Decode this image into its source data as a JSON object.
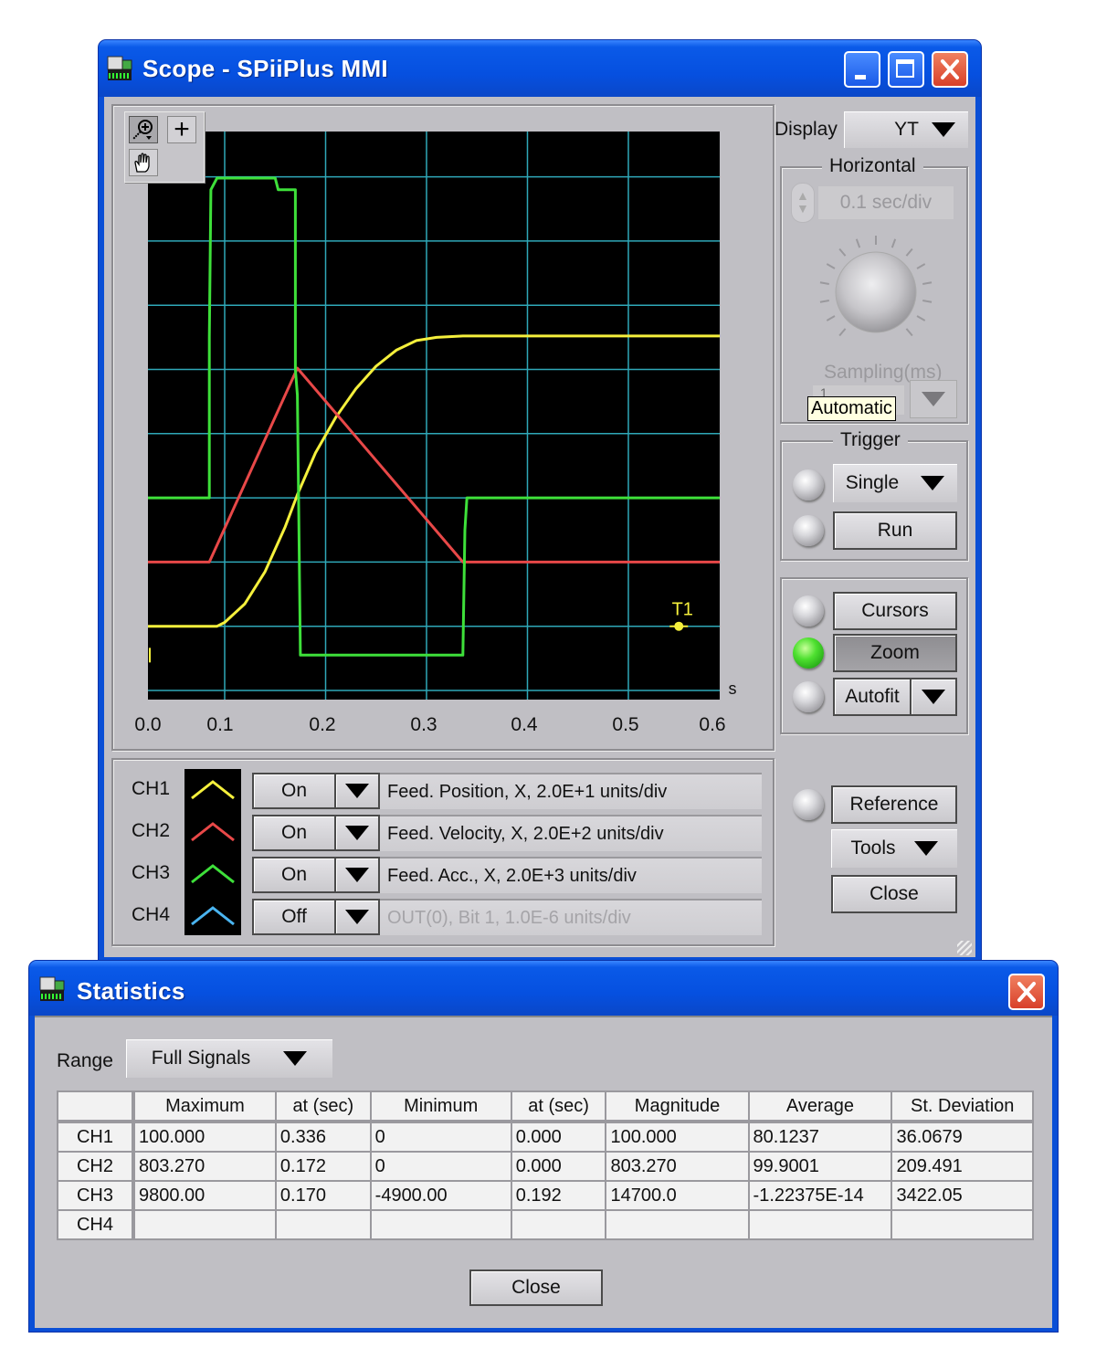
{
  "scope_window": {
    "title": "Scope - SPiiPlus MMI",
    "controls": {
      "minimize": "minimize",
      "maximize": "maximize",
      "close": "close"
    },
    "toolbar": {
      "zoom_tool": "zoom-in-tool",
      "crosshair_tool": "crosshair-tool",
      "pan_tool": "pan-hand-tool"
    },
    "display": {
      "label": "Display",
      "value": "YT"
    },
    "horizontal": {
      "group_label": "Horizontal",
      "value": "0.1 sec/div",
      "sampling_label": "Sampling(ms)",
      "sampling_value": "1",
      "tooltip": "Automatic"
    },
    "trigger": {
      "group_label": "Trigger",
      "mode": "Single",
      "run_label": "Run",
      "mode_led_on": false,
      "run_led_on": false
    },
    "view": {
      "cursors_label": "Cursors",
      "zoom_label": "Zoom",
      "autofit_label": "Autofit",
      "cursors_led_on": false,
      "zoom_led_on": true,
      "autofit_led_on": false
    },
    "misc": {
      "reference_label": "Reference",
      "tools_label": "Tools",
      "close_label": "Close",
      "reference_led_on": false
    },
    "channels": [
      {
        "name": "CH1",
        "state": "On",
        "description": "Feed. Position, X, 2.0E+1 units/div",
        "color": "#f5f03c",
        "enabled": true
      },
      {
        "name": "CH2",
        "state": "On",
        "description": "Feed. Velocity, X, 2.0E+2 units/div",
        "color": "#e84848",
        "enabled": true
      },
      {
        "name": "CH3",
        "state": "On",
        "description": "Feed. Acc., X, 2.0E+3 units/div",
        "color": "#3ee03a",
        "enabled": true
      },
      {
        "name": "CH4",
        "state": "Off",
        "description": "OUT(0), Bit 1, 1.0E-6 units/div",
        "color": "#4ab4f0",
        "enabled": false
      }
    ]
  },
  "chart_data": {
    "type": "line",
    "title": "",
    "xlabel": "s",
    "ylabel": "",
    "xlim": [
      0.0,
      0.6
    ],
    "x_ticks": [
      "0.0",
      "0.1",
      "0.2",
      "0.3",
      "0.4",
      "0.5",
      "0.6"
    ],
    "grid": true,
    "y_divisions_units": "div",
    "ylim_div": [
      -0.3,
      8.5
    ],
    "trigger_marker": {
      "label": "T1",
      "x": 0.55,
      "y_div": 1.0,
      "color": "#f5f03c"
    },
    "series": [
      {
        "name": "CH1 Feed. Position",
        "color": "#f5f03c",
        "points": [
          [
            0.0,
            1.0
          ],
          [
            0.09,
            1.0
          ],
          [
            0.1,
            1.06
          ],
          [
            0.12,
            1.35
          ],
          [
            0.14,
            1.85
          ],
          [
            0.16,
            2.55
          ],
          [
            0.172,
            3.05
          ],
          [
            0.19,
            3.7
          ],
          [
            0.21,
            4.25
          ],
          [
            0.23,
            4.7
          ],
          [
            0.25,
            5.05
          ],
          [
            0.27,
            5.3
          ],
          [
            0.29,
            5.45
          ],
          [
            0.31,
            5.5
          ],
          [
            0.336,
            5.52
          ],
          [
            0.6,
            5.52
          ]
        ]
      },
      {
        "name": "CH2 Feed. Velocity",
        "color": "#e84848",
        "points": [
          [
            0.0,
            2.0
          ],
          [
            0.08,
            2.0
          ],
          [
            0.172,
            5.02
          ],
          [
            0.336,
            2.0
          ],
          [
            0.6,
            2.0
          ]
        ]
      },
      {
        "name": "CH3 Feed. Acc.",
        "color": "#3ee03a",
        "points": [
          [
            0.0,
            3.0
          ],
          [
            0.08,
            3.0
          ],
          [
            0.08,
            5.5
          ],
          [
            0.082,
            7.8
          ],
          [
            0.09,
            7.98
          ],
          [
            0.15,
            7.98
          ],
          [
            0.153,
            7.8
          ],
          [
            0.17,
            7.8
          ],
          [
            0.17,
            5.0
          ],
          [
            0.172,
            4.6
          ],
          [
            0.175,
            0.55
          ],
          [
            0.178,
            0.55
          ],
          [
            0.336,
            0.55
          ],
          [
            0.338,
            2.5
          ],
          [
            0.34,
            3.0
          ],
          [
            0.6,
            3.0
          ]
        ]
      }
    ]
  },
  "statistics_window": {
    "title": "Statistics",
    "range_label": "Range",
    "range_value": "Full Signals",
    "close_label": "Close",
    "columns": [
      "",
      "Maximum",
      "at (sec)",
      "Minimum",
      "at (sec)",
      "Magnitude",
      "Average",
      "St. Deviation"
    ],
    "rows": [
      [
        "CH1",
        "100.000",
        "0.336",
        "0",
        "0.000",
        "100.000",
        "80.1237",
        "36.0679"
      ],
      [
        "CH2",
        "803.270",
        "0.172",
        "0",
        "0.000",
        "803.270",
        "99.9001",
        "209.491"
      ],
      [
        "CH3",
        "9800.00",
        "0.170",
        "-4900.00",
        "0.192",
        "14700.0",
        "-1.22375E-14",
        "3422.05"
      ],
      [
        "CH4",
        "",
        "",
        "",
        "",
        "",
        "",
        ""
      ]
    ]
  }
}
